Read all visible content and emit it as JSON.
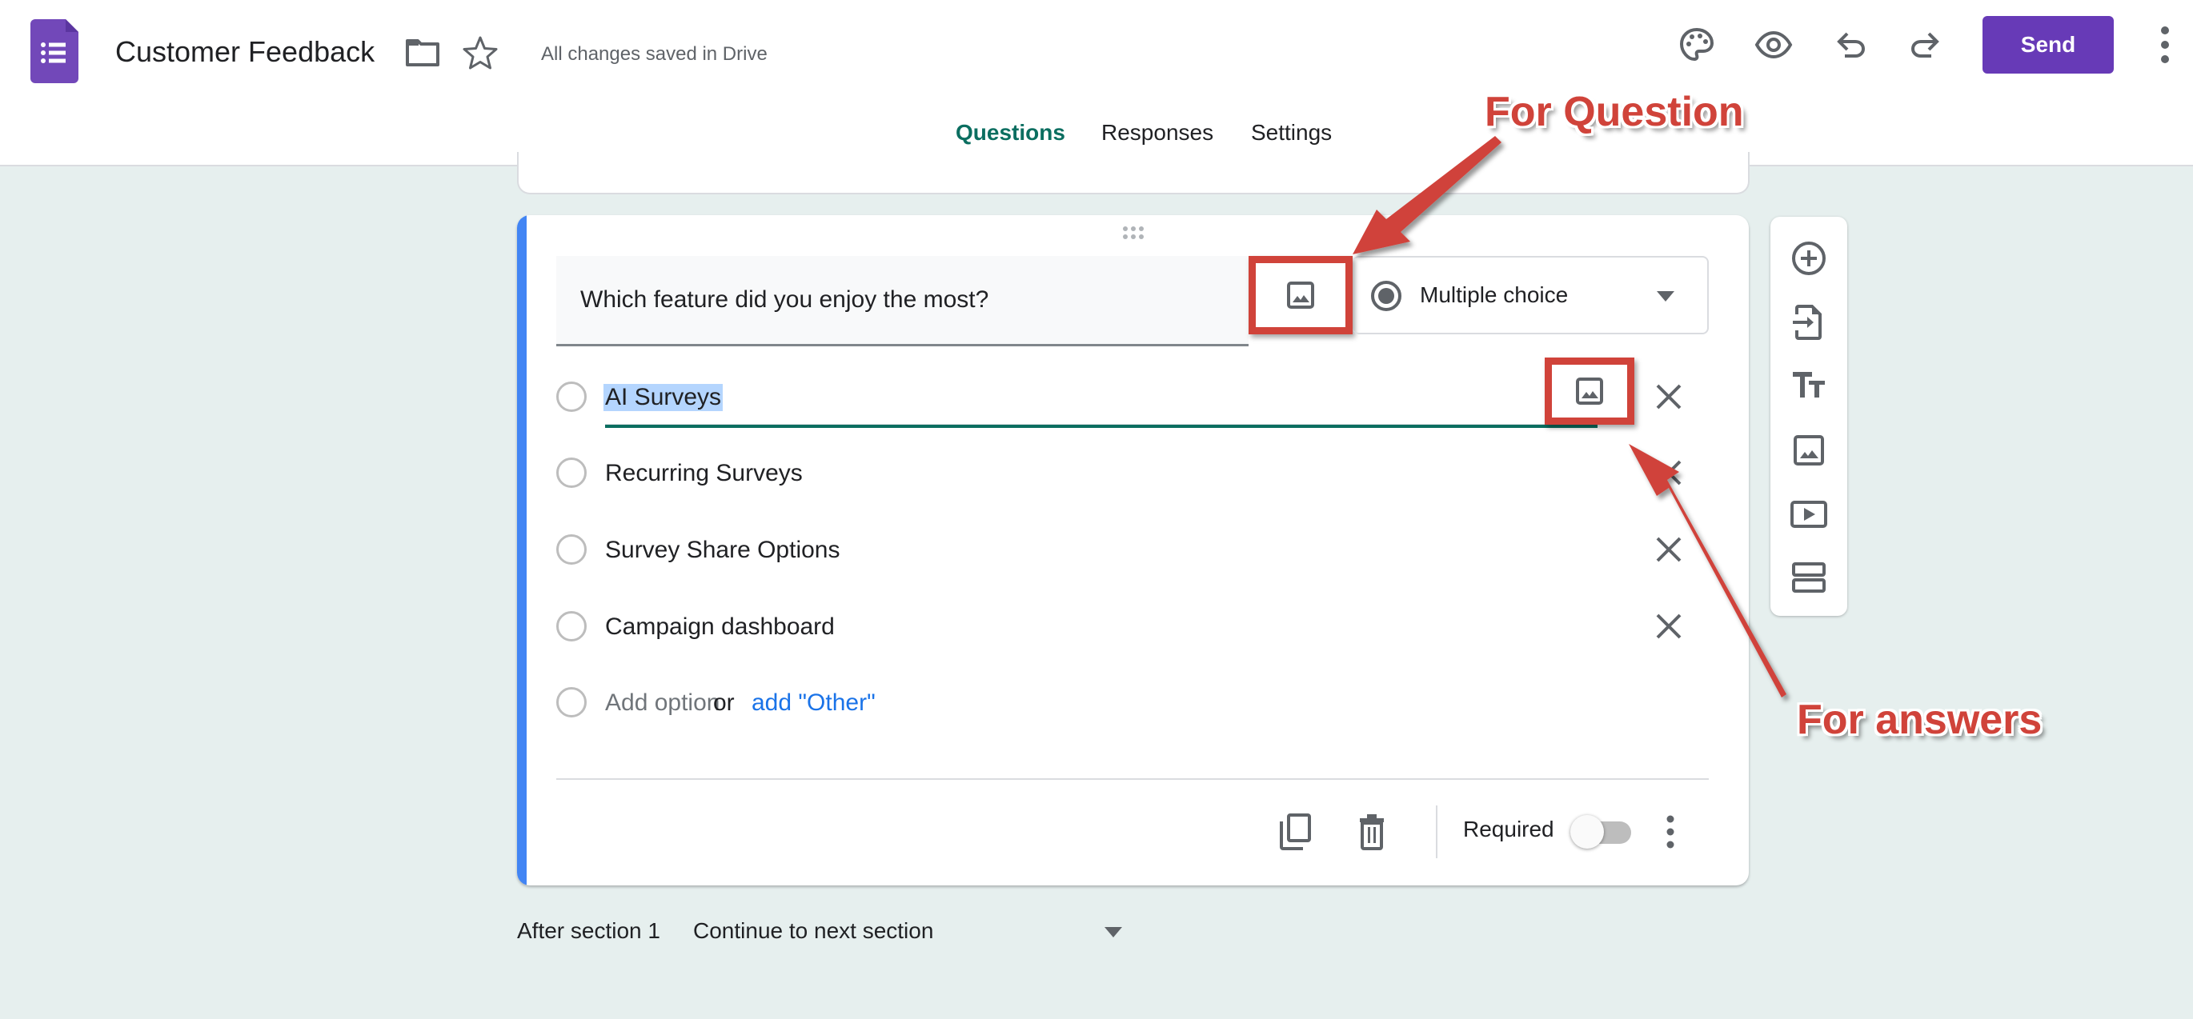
{
  "header": {
    "form_title": "Customer Feedback",
    "save_status": "All changes saved in Drive",
    "send_label": "Send",
    "icons": [
      "forms-logo-icon",
      "folder-icon",
      "star-icon",
      "palette-icon",
      "eye-icon",
      "undo-icon",
      "redo-icon",
      "more-vert-icon"
    ]
  },
  "tabs": [
    {
      "label": "Questions",
      "active": true
    },
    {
      "label": "Responses",
      "active": false
    },
    {
      "label": "Settings",
      "active": false
    }
  ],
  "question": {
    "title": "Which feature did you enjoy the most?",
    "type": "Multiple choice",
    "options": [
      {
        "label": "AI Surveys",
        "selected_text": true
      },
      {
        "label": "Recurring Surveys"
      },
      {
        "label": "Survey Share Options"
      },
      {
        "label": "Campaign dashboard"
      }
    ],
    "add_option_label": "Add option",
    "or_label": "or",
    "add_other_label": "add \"Other\"",
    "required_label": "Required",
    "required": false
  },
  "side_toolbar": {
    "items": [
      {
        "name": "add-question",
        "icon": "add-circle-icon"
      },
      {
        "name": "import-questions",
        "icon": "import-file-icon"
      },
      {
        "name": "add-title-description",
        "icon": "text-title-icon"
      },
      {
        "name": "add-image",
        "icon": "image-icon"
      },
      {
        "name": "add-video",
        "icon": "video-icon"
      },
      {
        "name": "add-section",
        "icon": "section-icon"
      }
    ]
  },
  "section_nav": {
    "label": "After section 1",
    "value": "Continue to next section"
  },
  "annotations": {
    "question_label": "For Question",
    "answers_label": "For answers"
  },
  "colors": {
    "brand": "#673ab7",
    "accent_teal": "#0b6e60",
    "card_accent": "#4285f4",
    "annotation_red": "#d0433a",
    "link_blue": "#1a73e8",
    "background": "#e6efee"
  }
}
